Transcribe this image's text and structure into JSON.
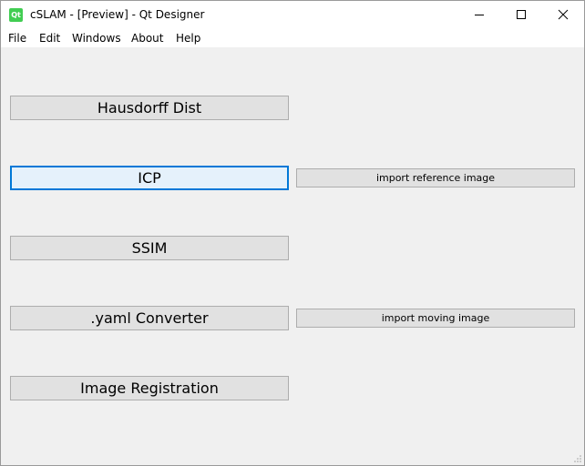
{
  "window": {
    "title": "cSLAM - [Preview] - Qt Designer",
    "icon_label": "Qt"
  },
  "titlebar_buttons": [
    "minimize-icon",
    "maximize-icon",
    "close-icon"
  ],
  "menubar": {
    "items": [
      {
        "label": "File"
      },
      {
        "label": "Edit"
      },
      {
        "label": "Windows"
      },
      {
        "label": "About"
      },
      {
        "label": "Help"
      }
    ]
  },
  "buttons": {
    "hausdorff": "Hausdorff Dist",
    "icp": "ICP",
    "ssim": "SSIM",
    "yaml": ".yaml Converter",
    "registration": "Image Registration",
    "import_reference": "import reference image",
    "import_moving": "import moving image"
  },
  "colors": {
    "focus_border": "#0078d7",
    "button_face": "#e1e1e1",
    "window_bg": "#f0f0f0"
  }
}
